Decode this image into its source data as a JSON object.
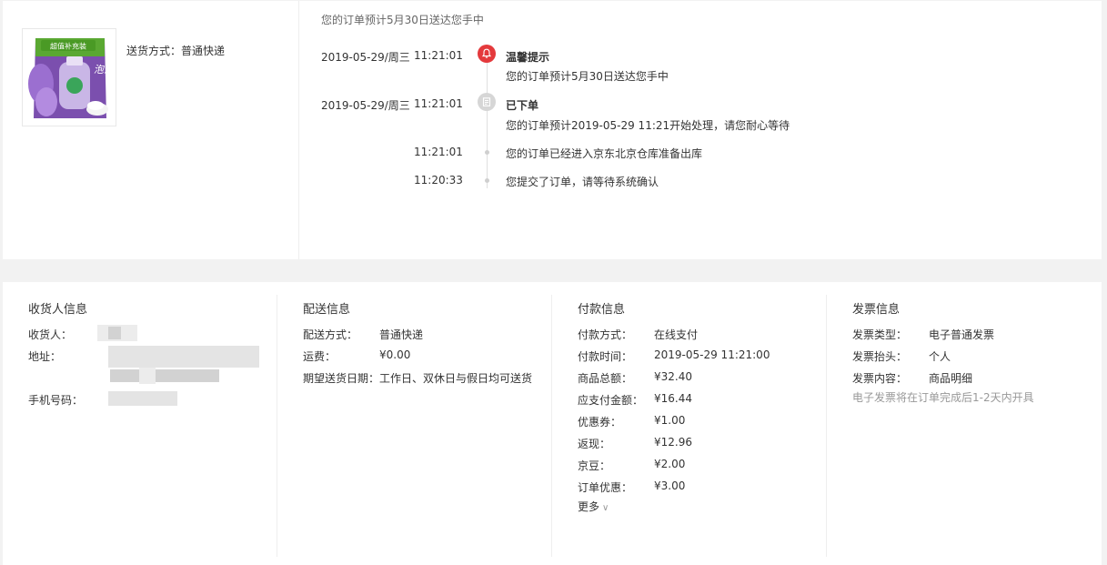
{
  "order_tracking": {
    "shipping_method": "送货方式：普通快递",
    "headline": "您的订单预计5月30日送达您手中",
    "product_image": {
      "name": "dettol-hand-wash-refill",
      "badge_text": "超值补充装",
      "brand_text": "泡沫"
    },
    "events": [
      {
        "date": "2019-05-29/周三",
        "time": "11:21:01",
        "icon": "bell-icon",
        "title": "温馨提示",
        "desc": "您的订单预计5月30日送达您手中"
      },
      {
        "date": "2019-05-29/周三",
        "time": "11:21:01",
        "icon": "order-icon",
        "title": "已下单",
        "desc": "您的订单预计2019-05-29 11:21开始处理，请您耐心等待"
      },
      {
        "date": "",
        "time": "11:21:01",
        "icon": "dot",
        "title": "",
        "desc": "您的订单已经进入京东北京仓库准备出库"
      },
      {
        "date": "",
        "time": "11:20:33",
        "icon": "dot",
        "title": "",
        "desc": "您提交了订单，请等待系统确认"
      }
    ]
  },
  "info": {
    "consignee": {
      "title": "收货人信息",
      "rows": [
        {
          "label": "收货人："
        },
        {
          "label": "地址："
        },
        {
          "label": "手机号码："
        }
      ]
    },
    "delivery": {
      "title": "配送信息",
      "rows": [
        {
          "label": "配送方式：",
          "value": "普通快递"
        },
        {
          "label": "运费：",
          "value": "¥0.00"
        },
        {
          "label": "期望送货日期：",
          "value": "工作日、双休日与假日均可送货"
        }
      ]
    },
    "payment": {
      "title": "付款信息",
      "rows": [
        {
          "label": "付款方式：",
          "value": "在线支付"
        },
        {
          "label": "付款时间：",
          "value": "2019-05-29 11:21:00"
        },
        {
          "label": "商品总额：",
          "value": "¥32.40"
        },
        {
          "label": "应支付金额：",
          "value": "¥16.44"
        },
        {
          "label": "优惠券：",
          "value": "¥1.00"
        },
        {
          "label": "返现：",
          "value": "¥12.96"
        },
        {
          "label": "京豆：",
          "value": "¥2.00"
        },
        {
          "label": "订单优惠：",
          "value": "¥3.00"
        }
      ],
      "more_label": "更多"
    },
    "invoice": {
      "title": "发票信息",
      "rows": [
        {
          "label": "发票类型：",
          "value": "电子普通发票"
        },
        {
          "label": "发票抬头：",
          "value": "个人"
        },
        {
          "label": "发票内容：",
          "value": "商品明细"
        }
      ],
      "note": "电子发票将在订单完成后1-2天内开具"
    }
  },
  "colors": {
    "accent": "#e4393c",
    "muted": "#999999",
    "timeline_gray": "#d6d6d6"
  }
}
